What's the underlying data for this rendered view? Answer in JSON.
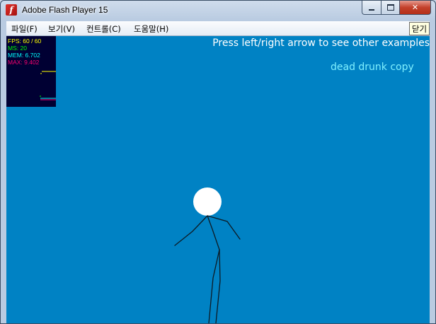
{
  "window": {
    "title": "Adobe Flash Player 15"
  },
  "menu": {
    "items": [
      "파일(F)",
      "보기(V)",
      "컨트롤(C)",
      "도움말(H)"
    ],
    "close_label": "닫기"
  },
  "stats": {
    "fps": "FPS: 60 / 60",
    "ms": "MS: 20",
    "mem": "MEM: 6.702",
    "max": "MAX: 9.402",
    "colors": {
      "fps": "#ffff00",
      "ms": "#00ff00",
      "mem": "#00ffff",
      "max": "#ff0070"
    }
  },
  "stage": {
    "instructions": "Press left/right arrow to see other examples",
    "example_name": "dead drunk copy",
    "background": "#0082c4"
  }
}
